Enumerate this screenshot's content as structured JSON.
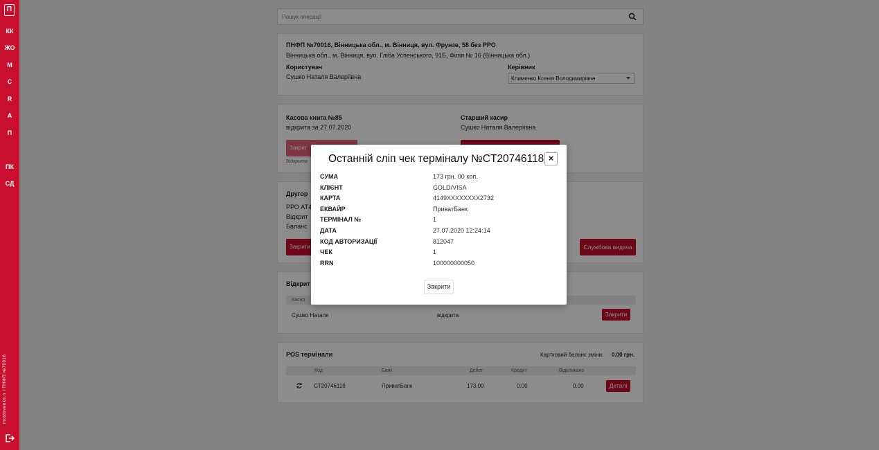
{
  "sidebar": {
    "logo": "П",
    "items": [
      "КК",
      "ЖО",
      "М",
      "С",
      "R",
      "А",
      "П",
      "ПК",
      "СД"
    ],
    "vertical_text": "mostovenko.n / ПНФП №70016"
  },
  "search": {
    "placeholder": "Пошук операції"
  },
  "branch": {
    "title": "ПНФП №70016, Вінницька обл., м. Вінниця, вул. Фрунзе, 58 без РРО",
    "address": "Вінницька обл., м. Вінниця, вул. Гліба Успенського, 91Б, Філія № 16 (Вінницька обл.)",
    "user_label": "Користувач",
    "user_name": "Сушко Наталя Валеріївна",
    "manager_label": "Керівник",
    "manager_value": "Клименко Ксенія Володимирівна"
  },
  "cashbook": {
    "title": "Касова книга №85",
    "status": "відкрита за 27.07.2020",
    "senior_label": "Старший касир",
    "senior_name": "Сушко Наталя Валеріївна",
    "close_btn_partial": "Закрит",
    "note_partial": "Відкрита"
  },
  "other": {
    "title_partial": "Другор",
    "line1": "РРО АТ4",
    "line2": "Відкрит",
    "line3": "Баланс",
    "close_btn_partial": "Закрити",
    "service_btn": "Службова видача"
  },
  "opened": {
    "title_partial": "Відкрит",
    "col_cashier": "Касир",
    "row_name": "Сушко Наталя",
    "row_status": "відкрита",
    "row_btn": "Закрити"
  },
  "pos": {
    "title": "POS термінали",
    "balance_label": "Картковий баланс зміни:",
    "balance_value": "0.00 грн.",
    "columns": [
      "Код",
      "Банк",
      "Дебет",
      "Кредит",
      "Відкликано"
    ],
    "row": {
      "code": "CT20746118",
      "bank": "ПриватБанк",
      "debit": "173.00",
      "credit": "0.00",
      "revoked": "0.00",
      "btn": "Деталі"
    }
  },
  "modal": {
    "title": "Останній сліп чек терміналу №CT20746118",
    "close_icon": "×",
    "rows": [
      {
        "k": "СУМА",
        "v": "173 грн. 00 коп."
      },
      {
        "k": "КЛІЄНТ",
        "v": "GOLD/VISA"
      },
      {
        "k": "КАРТА",
        "v": "4149XXXXXXXX2732"
      },
      {
        "k": "ЕКВАЙР",
        "v": "ПриватБанк"
      },
      {
        "k": "ТЕРМІНАЛ №",
        "v": "1"
      },
      {
        "k": "ДАТА",
        "v": "27.07.2020 12:24:14"
      },
      {
        "k": "КОД АВТОРИЗАЦІЇ",
        "v": "812047"
      },
      {
        "k": "ЧЕК",
        "v": "1"
      },
      {
        "k": "RRN",
        "v": "100000000050"
      }
    ],
    "close_button": "Закрити"
  },
  "colors": {
    "accent": "#c8102e",
    "overlay": "rgba(0,0,0,0.45)"
  }
}
